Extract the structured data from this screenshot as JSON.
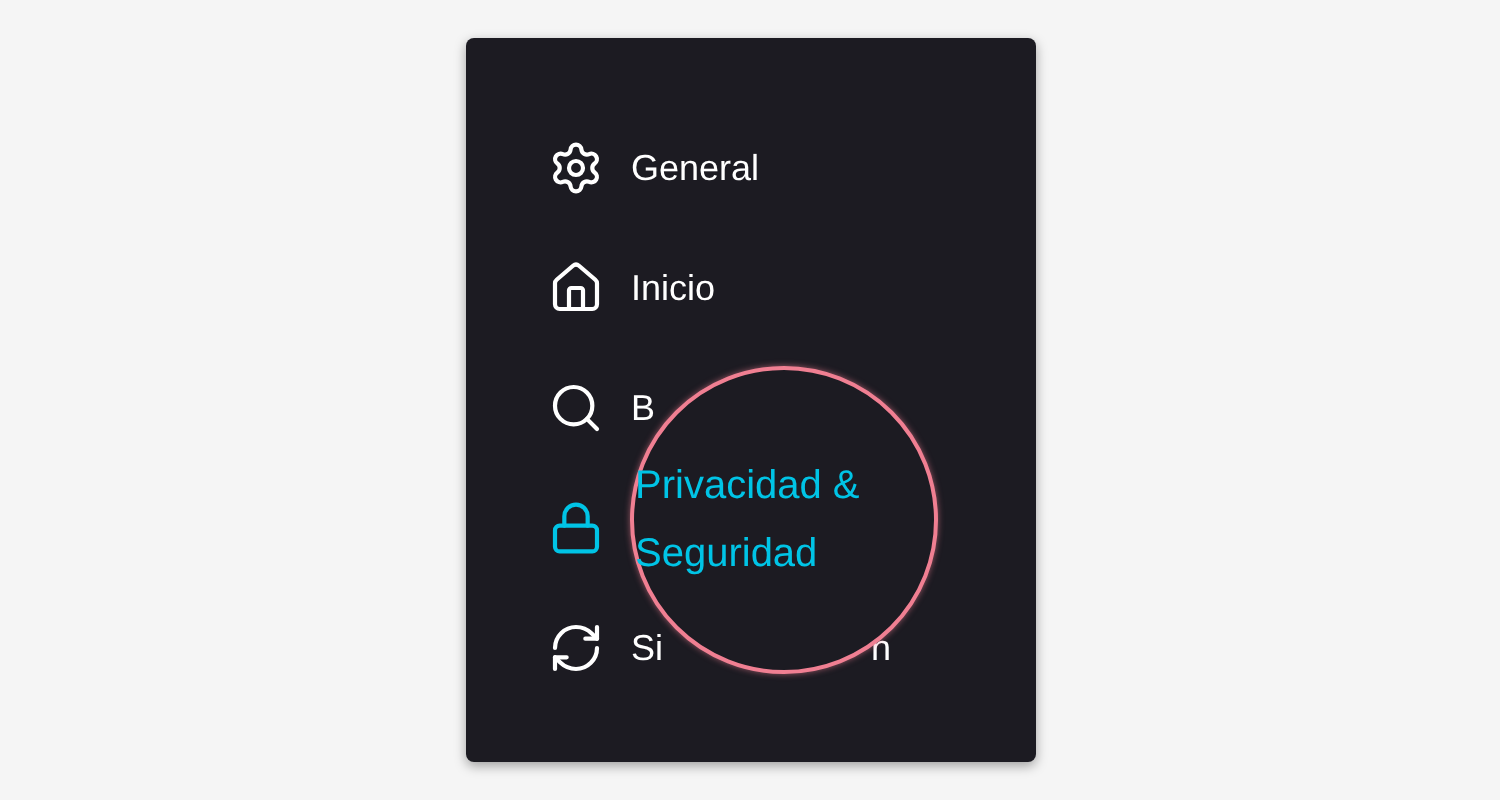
{
  "sidebar": {
    "items": [
      {
        "kind": "gear",
        "label": "General",
        "selected": false
      },
      {
        "kind": "home",
        "label": "Inicio",
        "selected": false
      },
      {
        "kind": "search",
        "label": "B",
        "selected": false
      },
      {
        "kind": "lock",
        "selected": true
      },
      {
        "kind": "sync",
        "label": "Si",
        "label_after": "n",
        "selected": false
      }
    ]
  },
  "magnifier": {
    "lines": [
      "Privacidad &",
      "Seguridad"
    ]
  }
}
